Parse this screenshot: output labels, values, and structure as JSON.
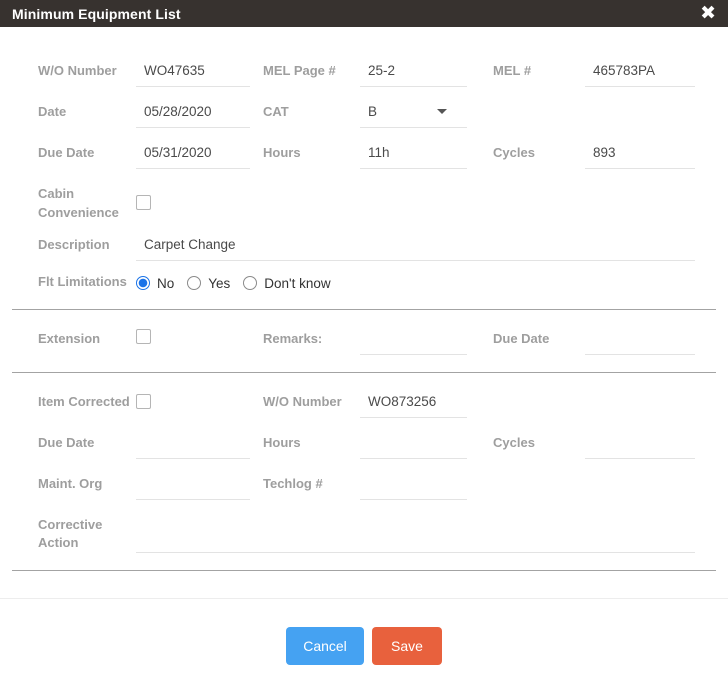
{
  "modal": {
    "title": "Minimum Equipment List",
    "close_icon": "✖"
  },
  "colors": {
    "header_bg": "#37322f",
    "cancel_blue": "#45a2f2",
    "save_orange": "#e8613d",
    "radio_selected_blue": "#1a73e8"
  },
  "fields": {
    "wo_number": {
      "label": "W/O Number",
      "value": "WO47635"
    },
    "mel_page": {
      "label": "MEL Page #",
      "value": "25-2"
    },
    "mel_no": {
      "label": "MEL #",
      "value": "465783PA"
    },
    "date": {
      "label": "Date",
      "value": "05/28/2020"
    },
    "cat": {
      "label": "CAT",
      "value": "B"
    },
    "due_date": {
      "label": "Due Date",
      "value": "05/31/2020"
    },
    "hours": {
      "label": "Hours",
      "value": "11h"
    },
    "cycles": {
      "label": "Cycles",
      "value": "893"
    },
    "cabin_convenience": {
      "label": "Cabin Convenience",
      "checked": false
    },
    "description": {
      "label": "Description",
      "value": "Carpet Change"
    },
    "flt_limitations": {
      "label": "Flt Limitations",
      "options": [
        "No",
        "Yes",
        "Don't know"
      ],
      "selected": "No"
    },
    "extension": {
      "label": "Extension",
      "checked": false
    },
    "remarks": {
      "label": "Remarks:",
      "value": ""
    },
    "ext_due_date": {
      "label": "Due Date",
      "value": ""
    },
    "item_corrected": {
      "label": "Item Corrected",
      "checked": false
    },
    "corr_wo_number": {
      "label": "W/O Number",
      "value": "WO873256"
    },
    "corr_due_date": {
      "label": "Due Date",
      "value": ""
    },
    "corr_hours": {
      "label": "Hours",
      "value": ""
    },
    "corr_cycles": {
      "label": "Cycles",
      "value": ""
    },
    "maint_org": {
      "label": "Maint. Org",
      "value": ""
    },
    "techlog": {
      "label": "Techlog #",
      "value": ""
    },
    "corrective_action": {
      "label": "Corrective Action",
      "value": ""
    }
  },
  "footer": {
    "cancel_label": "Cancel",
    "save_label": "Save"
  }
}
